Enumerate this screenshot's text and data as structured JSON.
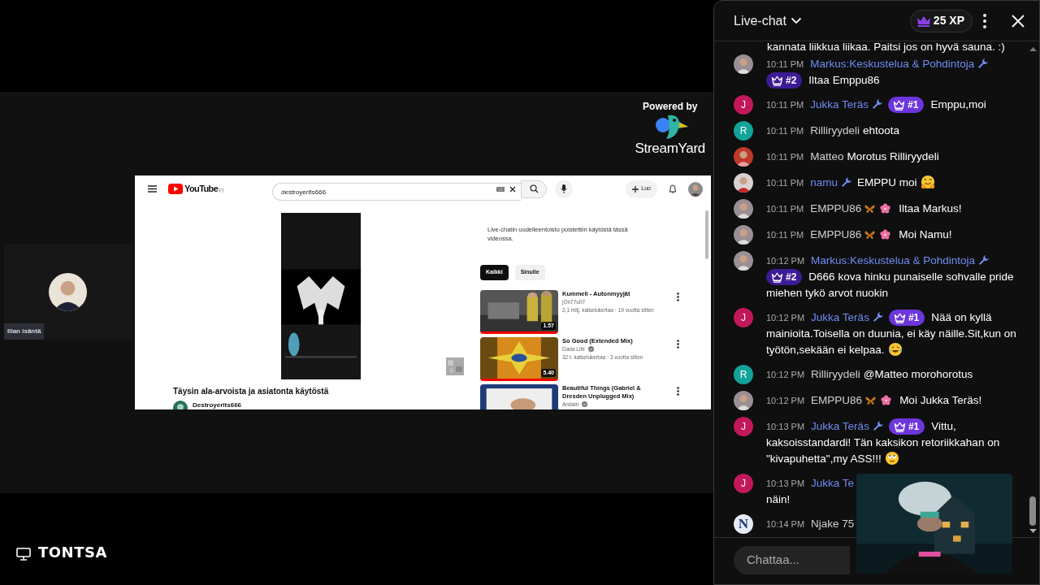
{
  "stage": {
    "host_tile": {
      "label": "Illan isäntä"
    },
    "branding": {
      "powered_by": "Powered by",
      "brand": "StreamYard"
    },
    "shared_screen": {
      "logo_text": "YouTube",
      "region": "FI",
      "search": {
        "value": "destroyerIts666"
      },
      "create_button": "Luo",
      "video_title": "Täysin ala-arvoista ja asiatonta käytöstä",
      "channel": "Destroyerits666",
      "chat_notice": "Live-chatin uudelleentoisto poistettiin käytöstä tässä videossa.",
      "chips": [
        {
          "label": "Kaikki",
          "selected": true
        },
        {
          "label": "Sinulle",
          "selected": false
        }
      ],
      "recommendations": [
        {
          "title": "Kummeli - Autonmyyjät",
          "channel": "jOn77u07",
          "verified": false,
          "meta": "2,1 milj. katselukertaa · 19 vuotta sitten",
          "duration": "1.57",
          "level": 1
        },
        {
          "title": "So Good (Extended Mix)",
          "channel": "Dada Life",
          "verified": true,
          "meta": "32 t. katselukertaa · 3 vuotta sitten",
          "duration": "5.40",
          "level": 1
        },
        {
          "title": "Beautiful Things (Gabriel & Dresden Unplugged Mix)",
          "channel": "Andain",
          "verified": true
        }
      ]
    }
  },
  "footer": {
    "label": "TONTSA"
  },
  "chat": {
    "title": "Live-chat",
    "xp": "25 XP",
    "messages": [
      {
        "kind": "continuation",
        "text": "kannata liikkua liikaa. Paitsi jos on hyvä sauna. :)"
      },
      {
        "kind": "message",
        "time": "10:11 PM",
        "author": "Markus:Keskustelua & Pohdintoja",
        "moderator": true,
        "wrench": true,
        "badges": false,
        "rank": {
          "label": "#2",
          "color": "#3e1b96"
        },
        "text": "Iltaa Emppu86"
      },
      {
        "kind": "message",
        "time": "10:11 PM",
        "author": "Jukka Teräs",
        "avatar": {
          "kind": "letter",
          "text": "J",
          "color": "#c2185b"
        },
        "moderator": true,
        "wrench": true,
        "badges": false,
        "rank": {
          "label": "#1",
          "color": "#6c36dc"
        },
        "text": "Emppu,moi"
      },
      {
        "kind": "message",
        "time": "10:11 PM",
        "author": "Rilliryydeli",
        "avatar": {
          "kind": "letter",
          "text": "R",
          "color": "#12a39a"
        },
        "moderator": false,
        "wrench": false,
        "badges": false,
        "text": "ehtoota"
      },
      {
        "kind": "message",
        "time": "10:11 PM",
        "author": "Matteo",
        "moderator": false,
        "wrench": false,
        "badges": false,
        "text": "Morotus Rilliryydeli"
      },
      {
        "kind": "message",
        "time": "10:11 PM",
        "author": "namu",
        "moderator": true,
        "wrench": true,
        "badges": false,
        "text": "EMPPU moi",
        "emoji": {
          "kind": "hugging"
        }
      },
      {
        "kind": "message",
        "time": "10:11 PM",
        "author": "EMPPU86",
        "moderator": false,
        "wrench": false,
        "badges": true,
        "text": "Iltaa Markus!"
      },
      {
        "kind": "message",
        "time": "10:11 PM",
        "author": "EMPPU86",
        "moderator": false,
        "wrench": false,
        "badges": true,
        "text": "Moi Namu!"
      },
      {
        "kind": "message",
        "time": "10:12 PM",
        "author": "Markus:Keskustelua & Pohdintoja",
        "moderator": true,
        "wrench": true,
        "badges": false,
        "rank": {
          "label": "#2",
          "color": "#3e1b96"
        },
        "text": "D666 kova hinku punaiselle sohvalle pride miehen tykö arvot nuokin"
      },
      {
        "kind": "message",
        "time": "10:12 PM",
        "author": "Jukka Teräs",
        "avatar": {
          "kind": "letter",
          "text": "J",
          "color": "#c2185b"
        },
        "moderator": true,
        "wrench": true,
        "badges": false,
        "rank": {
          "label": "#1",
          "color": "#6c36dc"
        },
        "text": "Nää on kyllä mainioita.Toisella on duunia, ei käy näille.Sit,kun on työtön,sekään ei kelpaa.",
        "emoji": {
          "kind": "laughing"
        }
      },
      {
        "kind": "message",
        "time": "10:12 PM",
        "author": "Rilliryydeli",
        "avatar": {
          "kind": "letter",
          "text": "R",
          "color": "#12a39a"
        },
        "moderator": false,
        "wrench": false,
        "badges": false,
        "text": "@Matteo morohorotus"
      },
      {
        "kind": "message",
        "time": "10:12 PM",
        "author": "EMPPU86",
        "moderator": false,
        "wrench": false,
        "badges": true,
        "text": "Moi Jukka Teräs!"
      },
      {
        "kind": "message",
        "time": "10:13 PM",
        "author": "Jukka Teräs",
        "avatar": {
          "kind": "letter",
          "text": "J",
          "color": "#c2185b"
        },
        "moderator": true,
        "wrench": true,
        "badges": false,
        "rank": {
          "label": "#1",
          "color": "#6c36dc"
        },
        "text": "Vittu, kaksoisstandardi! Tän kaksikon retoriikkahan on \"kivapuhetta\",my ASS!!!",
        "emoji": {
          "kind": "eye-roll"
        }
      },
      {
        "kind": "message",
        "time": "10:13 PM",
        "author": "Jukka Te",
        "avatar": {
          "kind": "letter",
          "text": "J",
          "color": "#c2185b"
        },
        "moderator": true,
        "wrench": false,
        "badges": false,
        "line_break": true,
        "text": "näin!"
      },
      {
        "kind": "message",
        "time": "10:14 PM",
        "author": "Njake 75",
        "avatar": {
          "kind": "logo",
          "text": "N",
          "color": "#e6eaf2"
        },
        "moderator": false,
        "wrench": false,
        "badges": false
      }
    ],
    "input": {
      "placeholder": "Chattaa..."
    }
  }
}
